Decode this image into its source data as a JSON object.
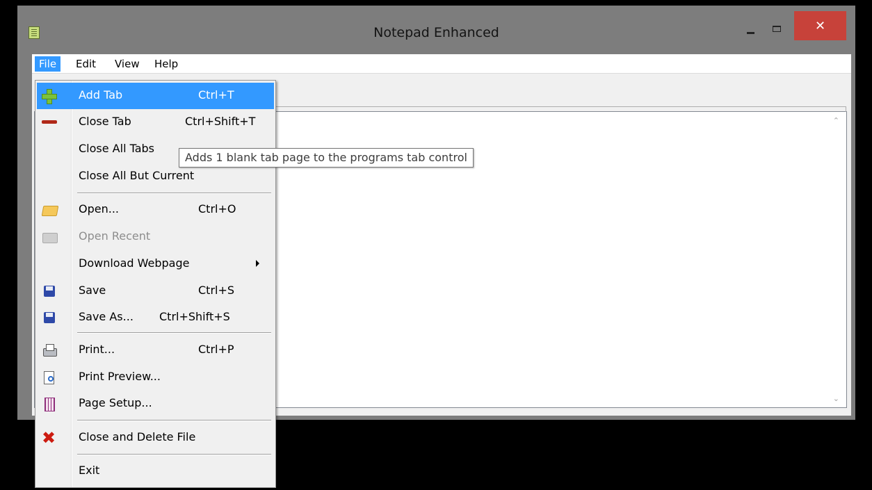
{
  "window": {
    "title": "Notepad Enhanced",
    "close_glyph": "✕"
  },
  "menubar": {
    "items": [
      "File",
      "Edit",
      "View",
      "Help"
    ]
  },
  "file_menu": {
    "items": [
      {
        "label": "Add Tab",
        "shortcut": "Ctrl+T",
        "icon": "add-icon",
        "highlighted": true
      },
      {
        "label": "Close Tab",
        "shortcut": "Ctrl+Shift+T",
        "icon": "remove-icon"
      },
      {
        "label": "Close All Tabs",
        "shortcut": ""
      },
      {
        "label": "Close All But Current",
        "shortcut": ""
      },
      {
        "label": "Open...",
        "shortcut": "Ctrl+O",
        "icon": "folder-icon"
      },
      {
        "label": "Open Recent",
        "shortcut": "",
        "icon": "folder-disabled-icon",
        "disabled": true
      },
      {
        "label": "Download Webpage",
        "shortcut": "",
        "submenu": true
      },
      {
        "label": "Save",
        "shortcut": "Ctrl+S",
        "icon": "save-icon"
      },
      {
        "label": "Save As...",
        "shortcut": "Ctrl+Shift+S",
        "icon": "save-as-icon"
      },
      {
        "label": "Print...",
        "shortcut": "Ctrl+P",
        "icon": "printer-icon"
      },
      {
        "label": "Print Preview...",
        "shortcut": "",
        "icon": "print-preview-icon"
      },
      {
        "label": "Page Setup...",
        "shortcut": "",
        "icon": "page-setup-icon"
      },
      {
        "label": "Close and Delete File",
        "shortcut": "",
        "icon": "delete-icon"
      },
      {
        "label": "Exit",
        "shortcut": ""
      }
    ]
  },
  "tooltip": {
    "text": "Adds 1 blank tab page to the programs tab control"
  },
  "colors": {
    "highlight": "#3399ff",
    "close_button": "#c7423a"
  }
}
